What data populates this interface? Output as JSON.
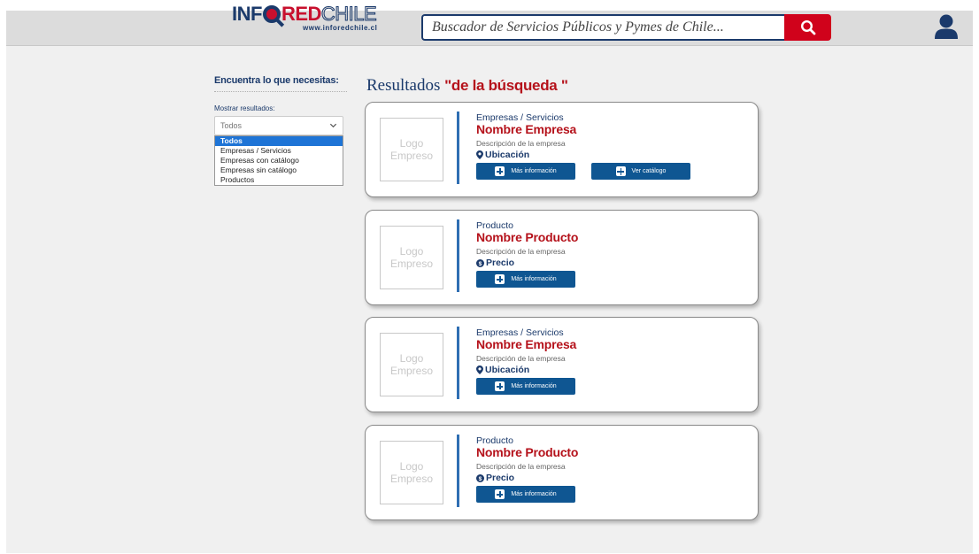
{
  "header": {
    "logo_info": "INF",
    "logo_red": "RED",
    "logo_chile": "CHILE",
    "logo_url": "www.inforedchile.cl",
    "search_placeholder": "Buscador de Servicios Públicos y Pymes de Chile...",
    "icons": {
      "search": "search-icon",
      "user": "user-icon"
    }
  },
  "sidebar": {
    "title": "Encuentra lo que necesitas:",
    "filter_label": "Mostrar resultados:",
    "select_value": "Todos",
    "options": [
      "Todos",
      "Empresas / Servicios",
      "Empresas con catálogo",
      "Empresas sin catálogo",
      "Productos"
    ],
    "selected_option": "Todos"
  },
  "results": {
    "title_prefix": "Resultados",
    "title_query": "\"de la búsqueda \"",
    "cards": [
      {
        "logo_line1": "Logo",
        "logo_line2": "Empreso",
        "category": "Empresas / Servicios",
        "name": "Nombre Empresa",
        "description": "Descripción de la empresa",
        "meta_icon": "location-pin-icon",
        "meta": "Ubicación",
        "button_info": "Más información",
        "button_catalog": "Ver catálogo"
      },
      {
        "logo_line1": "Logo",
        "logo_line2": "Empreso",
        "category": "Producto",
        "name": "Nombre Producto",
        "description": "Descripción de la empresa",
        "meta_icon": "price-icon",
        "meta": "Precio",
        "button_info": "Más información"
      },
      {
        "logo_line1": "Logo",
        "logo_line2": "Empreso",
        "category": "Empresas / Servicios",
        "name": "Nombre Empresa",
        "description": "Descripción de la empresa",
        "meta_icon": "location-pin-icon",
        "meta": "Ubicación",
        "button_info": "Más información"
      },
      {
        "logo_line1": "Logo",
        "logo_line2": "Empreso",
        "category": "Producto",
        "name": "Nombre Producto",
        "description": "Descripción de la empresa",
        "meta_icon": "price-icon",
        "meta": "Precio",
        "button_info": "Más información"
      }
    ]
  },
  "colors": {
    "navy": "#1b3a6b",
    "brand_red": "#b5121b",
    "search_red": "#d0021b",
    "button_blue": "#0f5692",
    "accent_bar": "#2f6fb3",
    "selected_option": "#1e74d6"
  }
}
